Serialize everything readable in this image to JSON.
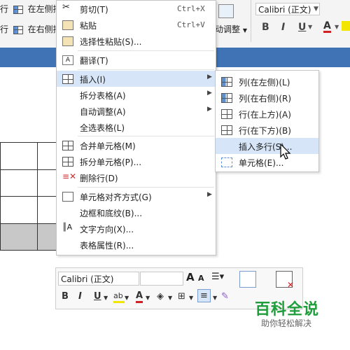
{
  "ribbon": {
    "row1_prefix": "行",
    "row1_label": "在左侧插",
    "row2_prefix": "行",
    "row2_label": "在右侧插",
    "autofit_label": "动调整",
    "font_name": "Calibri (正文)",
    "bold": "B",
    "italic": "I",
    "underline": "U",
    "font_color_letter": "A"
  },
  "context_menu": {
    "items": [
      {
        "label": "剪切(T)",
        "shortcut": "Ctrl+X",
        "icon": "scissors-icon"
      },
      {
        "label": "粘贴",
        "shortcut": "Ctrl+V",
        "icon": "paste-icon"
      },
      {
        "label": "选择性粘贴(S)...",
        "icon": "paste-special-icon"
      },
      {
        "label": "翻译(T)",
        "icon": "translate-icon"
      },
      {
        "label": "插入(I)",
        "icon": "insert-table-icon",
        "submenu": true,
        "highlighted": true
      },
      {
        "label": "拆分表格(A)",
        "submenu": true
      },
      {
        "label": "自动调整(A)",
        "submenu": true
      },
      {
        "label": "全选表格(L)"
      },
      {
        "label": "合并单元格(M)",
        "icon": "merge-cells-icon"
      },
      {
        "label": "拆分单元格(P)...",
        "icon": "split-cells-icon"
      },
      {
        "label": "删除行(D)",
        "icon": "delete-row-icon"
      },
      {
        "label": "单元格对齐方式(G)",
        "icon": "cell-align-icon",
        "submenu": true
      },
      {
        "label": "边框和底纹(B)..."
      },
      {
        "label": "文字方向(X)...",
        "icon": "text-direction-icon"
      },
      {
        "label": "表格属性(R)..."
      }
    ]
  },
  "submenu": {
    "items": [
      {
        "label": "列(在左侧)(L)",
        "icon": "col-left-icon"
      },
      {
        "label": "列(在右侧)(R)",
        "icon": "col-right-icon"
      },
      {
        "label": "行(在上方)(A)",
        "icon": "row-above-icon"
      },
      {
        "label": "行(在下方)(B)",
        "icon": "row-below-icon"
      },
      {
        "label": "插入多行(S)...",
        "highlighted": true
      },
      {
        "label": "单元格(E)...",
        "icon": "cells-icon"
      }
    ]
  },
  "mini_toolbar": {
    "font_name": "Calibri (正文)",
    "grow_font": "A",
    "shrink_font": "A",
    "bold": "B",
    "italic": "I",
    "underline": "U",
    "font_color_letter": "A"
  },
  "watermark": {
    "title": "百科全说",
    "subtitle": "助你轻松解决"
  },
  "colors": {
    "ribbon_blue": "#3f73b6",
    "menu_highlight": "#d6e6f8",
    "watermark_green": "#1e9e3a",
    "font_color_red": "#d02020",
    "highlight_yellow": "#f2e600"
  }
}
